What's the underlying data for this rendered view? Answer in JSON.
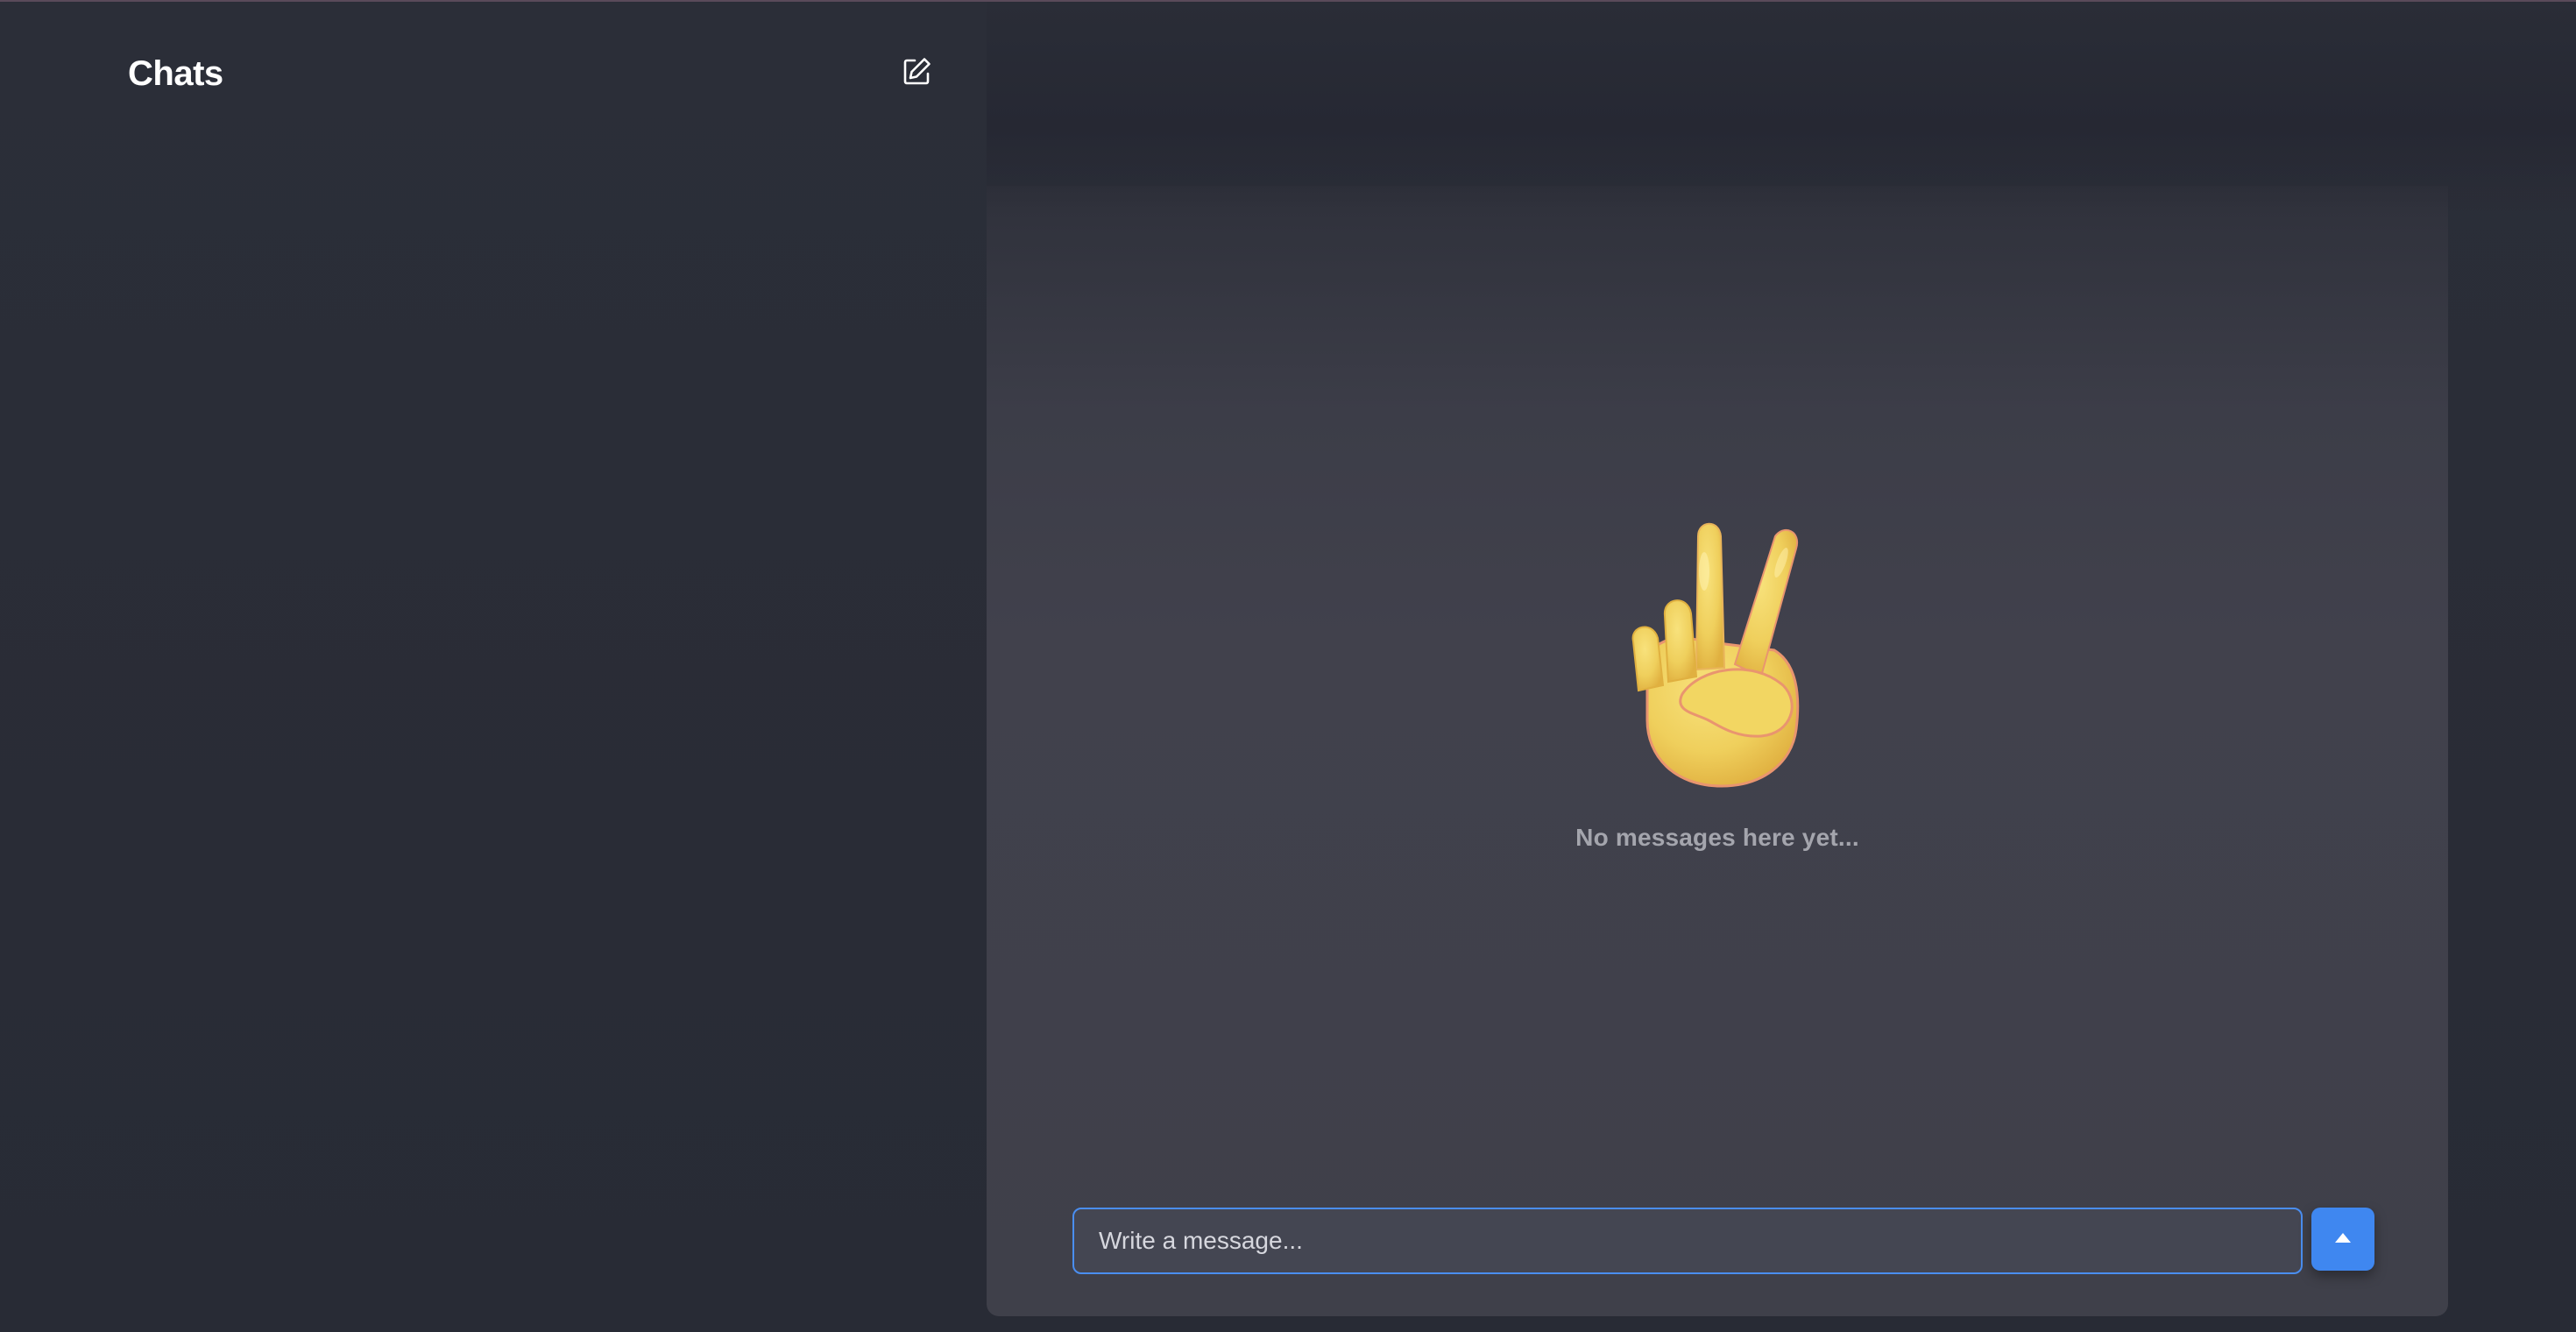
{
  "sidebar": {
    "title": "Chats",
    "compose_icon": "compose-icon"
  },
  "chat": {
    "empty_state": {
      "emoji": "victory-hand-emoji",
      "text": "No messages here yet..."
    },
    "composer": {
      "placeholder": "Write a message...",
      "value": "",
      "send_icon": "send-arrow-icon"
    }
  },
  "colors": {
    "accent": "#3f87f0",
    "background": "#292c35",
    "panel": "#41414c",
    "title_text": "#ffffff",
    "muted_text": "#a4a5ad"
  }
}
